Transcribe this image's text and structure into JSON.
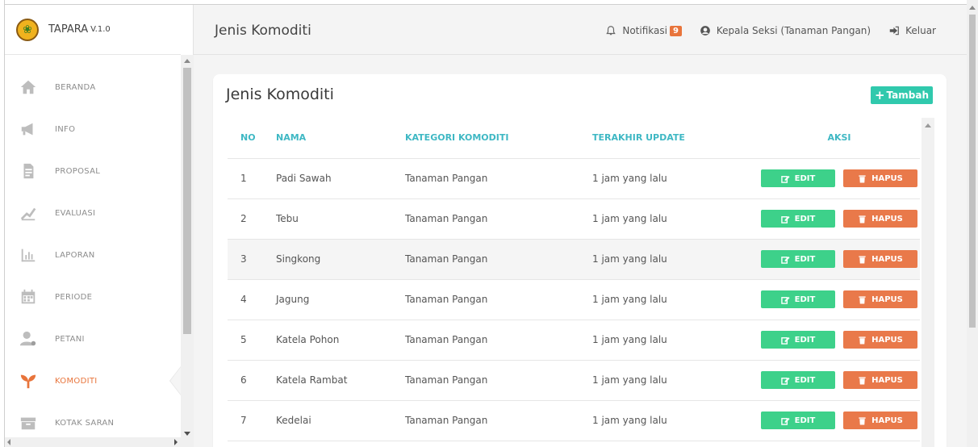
{
  "brand": {
    "name": "TAPARA",
    "version": "V.1.0"
  },
  "sidebar": {
    "items": [
      {
        "label": "BERANDA",
        "icon": "home-icon",
        "active": false
      },
      {
        "label": "INFO",
        "icon": "megaphone-icon",
        "active": false
      },
      {
        "label": "PROPOSAL",
        "icon": "document-icon",
        "active": false
      },
      {
        "label": "EVALUASI",
        "icon": "chart-line-icon",
        "active": false
      },
      {
        "label": "LAPORAN",
        "icon": "bar-chart-icon",
        "active": false
      },
      {
        "label": "PERIODE",
        "icon": "calendar-icon",
        "active": false
      },
      {
        "label": "PETANI",
        "icon": "user-icon",
        "active": false
      },
      {
        "label": "KOMODITI",
        "icon": "sprout-icon",
        "active": true
      },
      {
        "label": "KOTAK SARAN",
        "icon": "inbox-icon",
        "active": false
      }
    ]
  },
  "header": {
    "title": "Jenis Komoditi",
    "notification_label": "Notifikasi",
    "notification_count": "9",
    "user_label": "Kepala Seksi (Tanaman Pangan)",
    "logout_label": "Keluar"
  },
  "card": {
    "title": "Jenis Komoditi",
    "add_label": "Tambah"
  },
  "table": {
    "headers": {
      "no": "NO",
      "nama": "NAMA",
      "kategori": "KATEGORI KOMODITI",
      "update": "TERAKHIR UPDATE",
      "aksi": "AKSI"
    },
    "edit_label": "EDIT",
    "delete_label": "HAPUS",
    "rows": [
      {
        "no": "1",
        "nama": "Padi Sawah",
        "kategori": "Tanaman Pangan",
        "update": "1 jam yang lalu"
      },
      {
        "no": "2",
        "nama": "Tebu",
        "kategori": "Tanaman Pangan",
        "update": "1 jam yang lalu"
      },
      {
        "no": "3",
        "nama": "Singkong",
        "kategori": "Tanaman Pangan",
        "update": "1 jam yang lalu"
      },
      {
        "no": "4",
        "nama": "Jagung",
        "kategori": "Tanaman Pangan",
        "update": "1 jam yang lalu"
      },
      {
        "no": "5",
        "nama": "Katela Pohon",
        "kategori": "Tanaman Pangan",
        "update": "1 jam yang lalu"
      },
      {
        "no": "6",
        "nama": "Katela Rambat",
        "kategori": "Tanaman Pangan",
        "update": "1 jam yang lalu"
      },
      {
        "no": "7",
        "nama": "Kedelai",
        "kategori": "Tanaman Pangan",
        "update": "1 jam yang lalu"
      }
    ]
  },
  "colors": {
    "accent": "#e8743b",
    "teal": "#3fb8c4",
    "add": "#30c9ad",
    "edit": "#3dd18a",
    "delete": "#e9794a"
  }
}
